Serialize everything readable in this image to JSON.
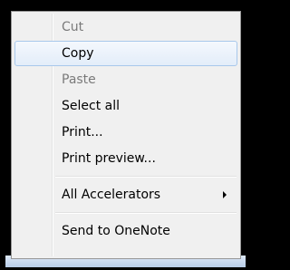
{
  "context_menu": {
    "items": [
      {
        "label": "Cut",
        "state": "disabled"
      },
      {
        "label": "Copy",
        "state": "highlighted"
      },
      {
        "label": "Paste",
        "state": "disabled"
      },
      {
        "label": "Select all",
        "state": "enabled"
      },
      {
        "label": "Print...",
        "state": "enabled"
      },
      {
        "label": "Print preview...",
        "state": "enabled"
      },
      {
        "label": "All Accelerators",
        "state": "enabled",
        "submenu_icon": "chevron-right-icon"
      },
      {
        "label": "Send to OneNote",
        "state": "enabled"
      }
    ]
  },
  "colors": {
    "menu_background": "#f0f0f0",
    "menu_border": "#979797",
    "highlight_border": "#a8c8eb",
    "disabled_text": "#7a7a7a"
  }
}
